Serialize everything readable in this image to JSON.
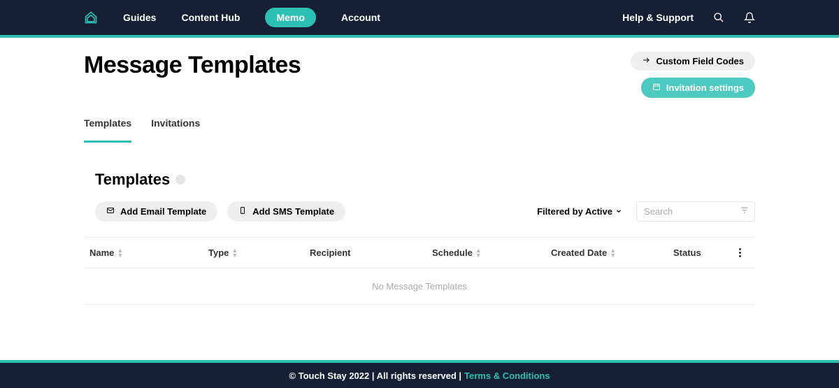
{
  "nav": {
    "links": [
      "Guides",
      "Content Hub",
      "Memo",
      "Account"
    ],
    "help": "Help & Support"
  },
  "page": {
    "title": "Message Templates"
  },
  "header_buttons": {
    "custom_codes": "Custom Field Codes",
    "invitation_settings": "Invitation settings"
  },
  "tabs": [
    "Templates",
    "Invitations"
  ],
  "section": {
    "title": "Templates"
  },
  "actions": {
    "add_email": "Add Email Template",
    "add_sms": "Add SMS Template"
  },
  "filter": {
    "label": "Filtered by Active"
  },
  "search": {
    "placeholder": "Search"
  },
  "table": {
    "headers": {
      "name": "Name",
      "type": "Type",
      "recipient": "Recipient",
      "schedule": "Schedule",
      "created": "Created Date",
      "status": "Status"
    },
    "empty": "No Message Templates"
  },
  "footer": {
    "copyright": "© Touch Stay 2022 | All rights reserved |",
    "terms": "Terms & Conditions"
  }
}
